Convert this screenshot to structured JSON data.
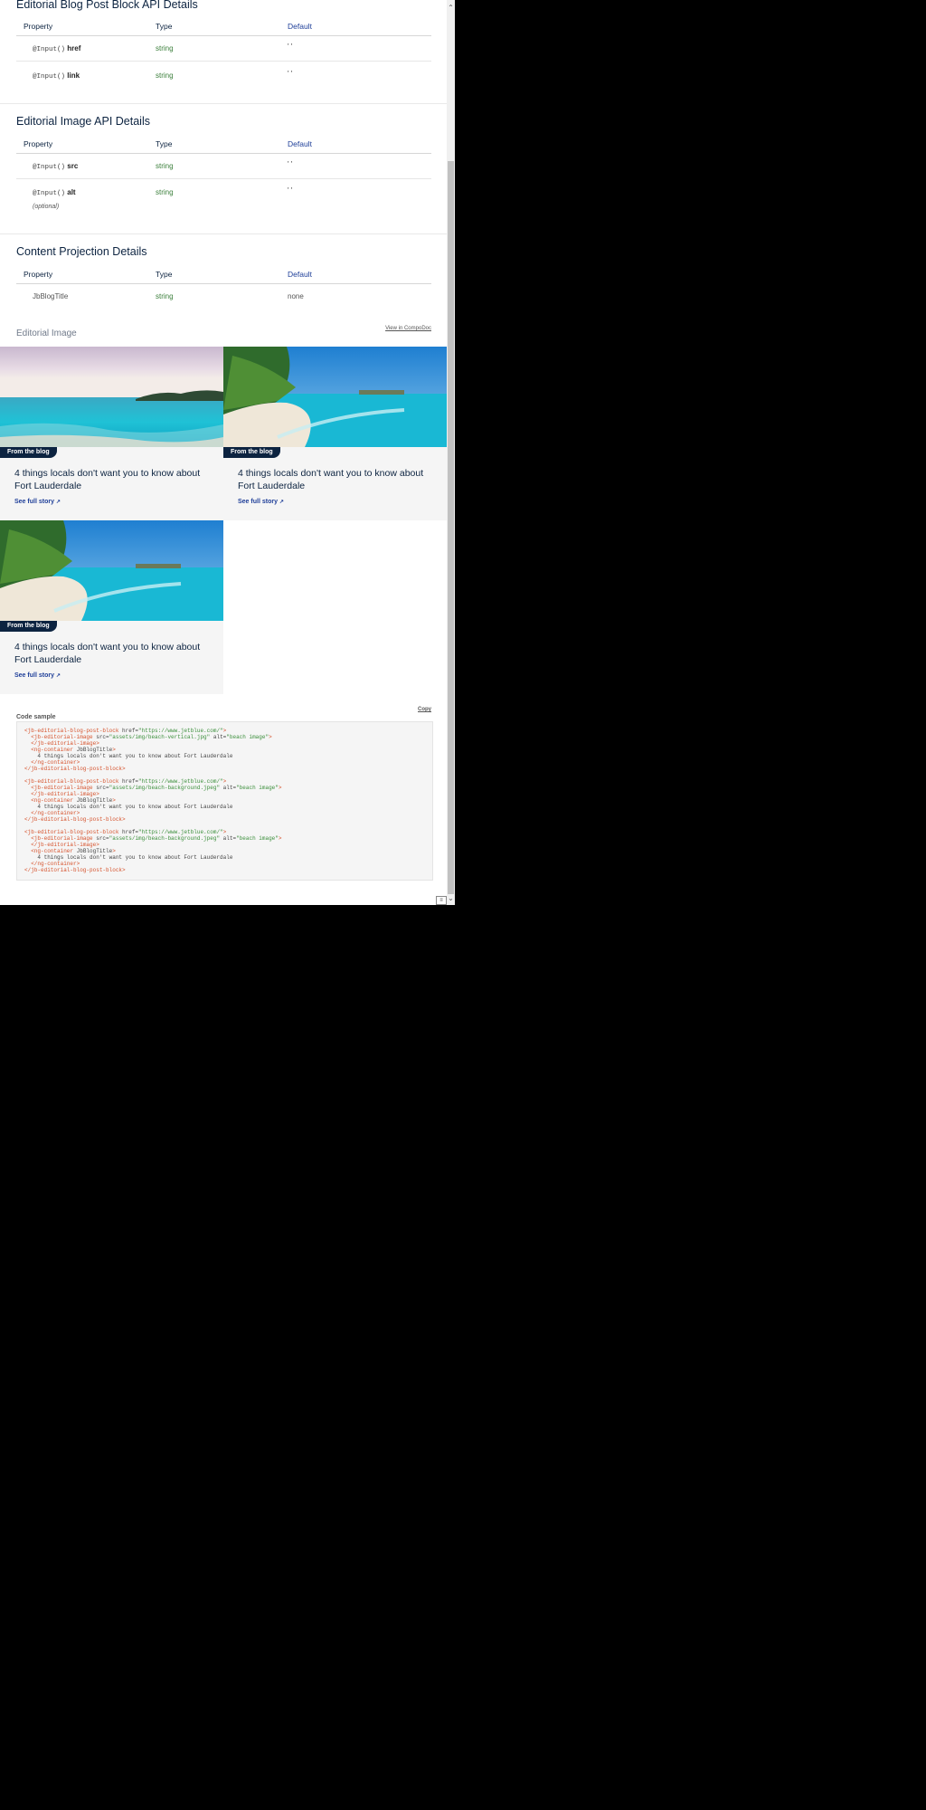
{
  "sections": {
    "blog_post_api": {
      "title": "Editorial Blog Post Block API Details",
      "headers": [
        "Property",
        "Type",
        "Default"
      ],
      "rows": [
        {
          "decorator": "@Input()",
          "name": "href",
          "type": "string",
          "default": "' '"
        },
        {
          "decorator": "@Input()",
          "name": "link",
          "type": "string",
          "default": "' '"
        }
      ]
    },
    "image_api": {
      "title": "Editorial Image API Details",
      "headers": [
        "Property",
        "Type",
        "Default"
      ],
      "rows": [
        {
          "decorator": "@Input()",
          "name": "src",
          "type": "string",
          "default": "' '"
        },
        {
          "decorator": "@Input()",
          "name": "alt",
          "type": "string",
          "default": "' '",
          "note": "(optional)"
        }
      ]
    },
    "content_projection": {
      "title": "Content Projection Details",
      "headers": [
        "Property",
        "Type",
        "Default"
      ],
      "rows": [
        {
          "name": "JbBlogTitle",
          "type": "string",
          "default": "none"
        }
      ]
    }
  },
  "editorial_image": {
    "title": "Editorial Image",
    "compodoc_link": "View in CompoDoc",
    "cards": [
      {
        "badge": "From the blog",
        "title": "4 things locals don't want you to know about Fort Lauderdale",
        "link": "See full story",
        "link_icon": "arrow-up-right-icon"
      },
      {
        "badge": "From the blog",
        "title": "4 things locals don't want you to know about Fort Lauderdale",
        "link": "See full story",
        "link_icon": "arrow-up-right-icon"
      },
      {
        "badge": "From the blog",
        "title": "4 things locals don't want you to know about Fort Lauderdale",
        "link": "See full story",
        "link_icon": "arrow-up-right-icon"
      }
    ]
  },
  "code_sample": {
    "label": "Code sample",
    "copy_label": "Copy",
    "lines": [
      "<jb-editorial-blog-post-block href=\"https://www.jetblue.com/\">",
      "  <jb-editorial-image src=\"assets/img/beach-vertical.jpg\" alt=\"beach image\">",
      "  </jb-editorial-image>",
      "  <ng-container JbBlogTitle>",
      "    4 things locals don't want you to know about Fort Lauderdale",
      "  </ng-container>",
      "</jb-editorial-blog-post-block>",
      "",
      "<jb-editorial-blog-post-block href=\"https://www.jetblue.com/\">",
      "  <jb-editorial-image src=\"assets/img/beach-background.jpeg\" alt=\"beach image\">",
      "  </jb-editorial-image>",
      "  <ng-container JbBlogTitle>",
      "    4 things locals don't want you to know about Fort Lauderdale",
      "  </ng-container>",
      "</jb-editorial-blog-post-block>",
      "",
      "<jb-editorial-blog-post-block href=\"https://www.jetblue.com/\">",
      "  <jb-editorial-image src=\"assets/img/beach-background.jpeg\" alt=\"beach image\">",
      "  </jb-editorial-image>",
      "  <ng-container JbBlogTitle>",
      "    4 things locals don't want you to know about Fort Lauderdale",
      "  </ng-container>",
      "</jb-editorial-blog-post-block>"
    ]
  },
  "colors": {
    "navy": "#0c2340",
    "link_blue": "#1f3f99",
    "code_tag": "#d6522c",
    "code_value": "#3b8f3b"
  }
}
